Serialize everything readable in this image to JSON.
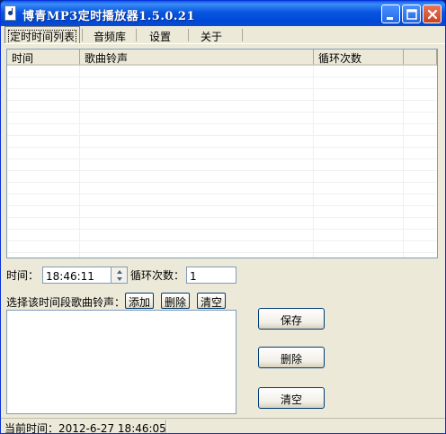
{
  "window": {
    "title": "博青MP3定时播放器1.5.0.21",
    "icon": "music-note-icon"
  },
  "tabs": [
    {
      "label": "定时时间列表",
      "active": true
    },
    {
      "label": "音频库",
      "active": false
    },
    {
      "label": "设置",
      "active": false
    },
    {
      "label": "关于",
      "active": false
    }
  ],
  "schedule_list": {
    "columns": [
      "时间",
      "歌曲铃声",
      "循环次数",
      ""
    ],
    "rows": []
  },
  "form": {
    "time_label": "时间：",
    "time_value": "18:46:11",
    "loop_label": "循环次数：",
    "loop_value": "1",
    "songs_label": "选择该时间段歌曲铃声：",
    "add_label": "添加",
    "delete_label": "删除",
    "clear_label": "清空"
  },
  "actions": {
    "save_label": "保存",
    "delete_label": "删除",
    "clear_label": "清空"
  },
  "status": {
    "current_time": "当前时间：2012-6-27 18:46:05"
  }
}
